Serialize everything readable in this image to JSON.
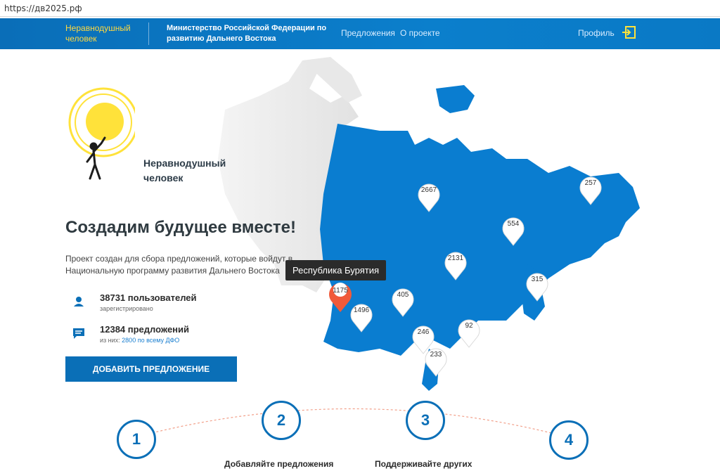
{
  "browser": {
    "url": "https://дв2025.рф"
  },
  "header": {
    "brand": "Неравнодушный человек",
    "ministry": "Министерство Российской Федерации по развитию Дальнего Востока",
    "nav": [
      "Предложения",
      "О проекте"
    ],
    "profile": "Профиль"
  },
  "colors": {
    "primary": "#0a6fb7",
    "accent_yellow": "#ffe23a",
    "pin_active": "#f05a3a",
    "map_gray": "#e6e6e6"
  },
  "logo": {
    "text": "Неравнодушный человек"
  },
  "hero": {
    "title": "Создадим будущее вместе!",
    "description": "Проект создан для сбора предложений, которые войдут в Национальную программу развития Дальнего Востока"
  },
  "stats": [
    {
      "icon": "user-icon",
      "value": "38731 пользователей",
      "sub": "зарегистрировано"
    },
    {
      "icon": "chat-icon",
      "value": "12384 предложений",
      "sub_prefix": "из них:",
      "sub_link": "2800 по всему ДФО"
    }
  ],
  "add_button": "ДОБАВИТЬ ПРЕДЛОЖЕНИЕ",
  "tooltip": "Республика Бурятия",
  "pins": [
    "2667",
    "257",
    "554",
    "2131",
    "315",
    "405",
    "1175",
    "1496",
    "246",
    "92",
    "233"
  ],
  "steps": [
    {
      "number": "1"
    },
    {
      "number": "2",
      "label": "Добавляйте предложения"
    },
    {
      "number": "3",
      "label": "Поддерживайте других"
    },
    {
      "number": "4"
    }
  ]
}
